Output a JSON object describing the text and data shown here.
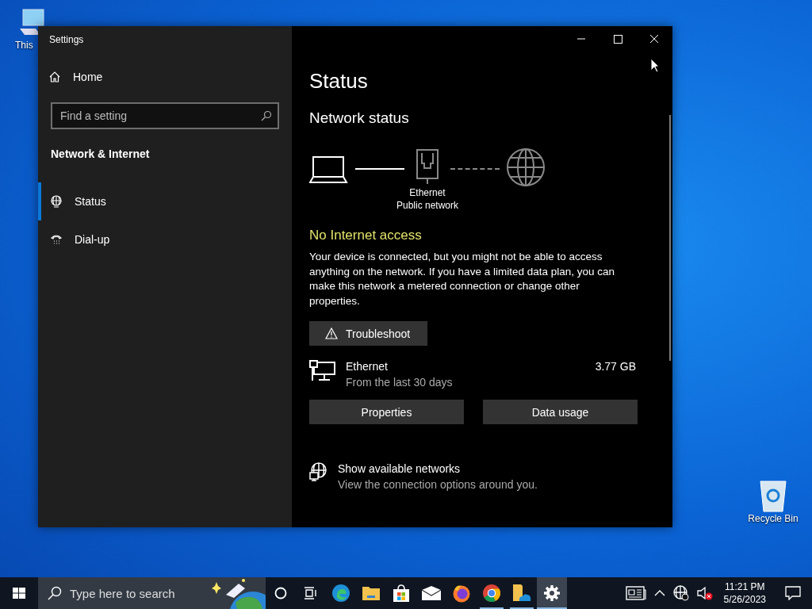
{
  "desktop": {
    "icons": [
      {
        "label": "This",
        "kind": "computer"
      },
      {
        "label": "Recycle Bin",
        "kind": "bin"
      }
    ]
  },
  "window": {
    "title": "Settings"
  },
  "sidebar": {
    "home": "Home",
    "search": {
      "placeholder": "Find a setting"
    },
    "section": "Network & Internet",
    "items": [
      {
        "label": "Status",
        "kind": "status",
        "selected": true
      },
      {
        "label": "Dial-up",
        "kind": "dialup",
        "selected": false
      }
    ]
  },
  "content": {
    "title": "Status",
    "subtitle": "Network status",
    "diagram": {
      "adapter": "Ethernet",
      "network": "Public network",
      "connected_to_internet": false
    },
    "alert": "No Internet access",
    "message": "Your device is connected, but you might not be able to access anything on the network. If you have a limited data plan, you can make this network a metered connection or change other properties.",
    "troubleshoot": "Troubleshoot",
    "connection": {
      "name": "Ethernet",
      "detail": "From the last 30 days",
      "usage": "3.77 GB"
    },
    "buttons": [
      "Properties",
      "Data usage"
    ],
    "link": {
      "title": "Show available networks",
      "detail": "View the connection options around you."
    }
  },
  "taskbar": {
    "search": {
      "placeholder": "Type here to search"
    },
    "apps": [
      {
        "kind": "cortana",
        "running": false,
        "selected": false
      },
      {
        "kind": "taskview",
        "running": false,
        "selected": false
      },
      {
        "kind": "edge",
        "running": false,
        "selected": false
      },
      {
        "kind": "explorer",
        "running": false,
        "selected": false
      },
      {
        "kind": "store",
        "running": false,
        "selected": false
      },
      {
        "kind": "mail",
        "running": false,
        "selected": false
      },
      {
        "kind": "firefox",
        "running": false,
        "selected": false
      },
      {
        "kind": "chrome",
        "running": true,
        "selected": false
      },
      {
        "kind": "files",
        "running": true,
        "selected": false
      },
      {
        "kind": "settings",
        "running": true,
        "selected": true
      }
    ],
    "clock": {
      "time": "11:21 PM",
      "date": "5/26/2023"
    }
  }
}
